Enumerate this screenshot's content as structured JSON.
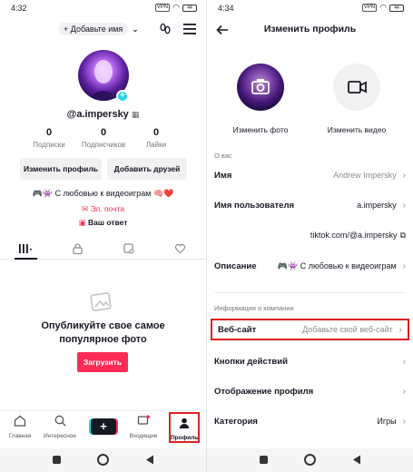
{
  "left": {
    "status": {
      "time": "4:32",
      "battery": "44"
    },
    "account_switch": "+ Добавьте имя",
    "username": "@a.impersky",
    "stats": [
      {
        "num": "0",
        "label": "Подписки"
      },
      {
        "num": "0",
        "label": "Подписчиков"
      },
      {
        "num": "0",
        "label": "Лайки"
      }
    ],
    "edit_profile": "Изменить профиль",
    "add_friends": "Добавить друзей",
    "bio": "🎮👾 С любовью к видеоиграм 🧠❤️",
    "email": "Эл. почта",
    "answer": "Ваш ответ",
    "empty_title_line1": "Опубликуйте свое самое",
    "empty_title_line2": "популярное фото",
    "upload": "Загрузить",
    "nav": {
      "home": "Главная",
      "discover": "Интересное",
      "inbox": "Входящие",
      "profile": "Профиль"
    }
  },
  "right": {
    "status": {
      "time": "4:34",
      "battery": "44"
    },
    "title": "Изменить профиль",
    "change_photo": "Изменить фото",
    "change_video": "Изменить видео",
    "about_section": "О вас",
    "rows": {
      "name": {
        "key": "Имя",
        "value": "Andrew Impersky"
      },
      "username": {
        "key": "Имя пользователя",
        "value": "a.impersky"
      },
      "link": "tiktok.com/@a.impersky",
      "description": {
        "key": "Описание",
        "value": "🎮👾 С любовью к видеоиграм"
      }
    },
    "company_section": "Информация о компании",
    "website": {
      "key": "Веб-сайт",
      "value": "Добавьте свой веб-сайт"
    },
    "action_buttons": "Кнопки действий",
    "profile_display": "Отображение профиля",
    "category": {
      "key": "Категория",
      "value": "Игры"
    }
  },
  "colors": {
    "accent": "#fe2c55",
    "cyan": "#20d5ec",
    "highlight": "#e02020"
  }
}
